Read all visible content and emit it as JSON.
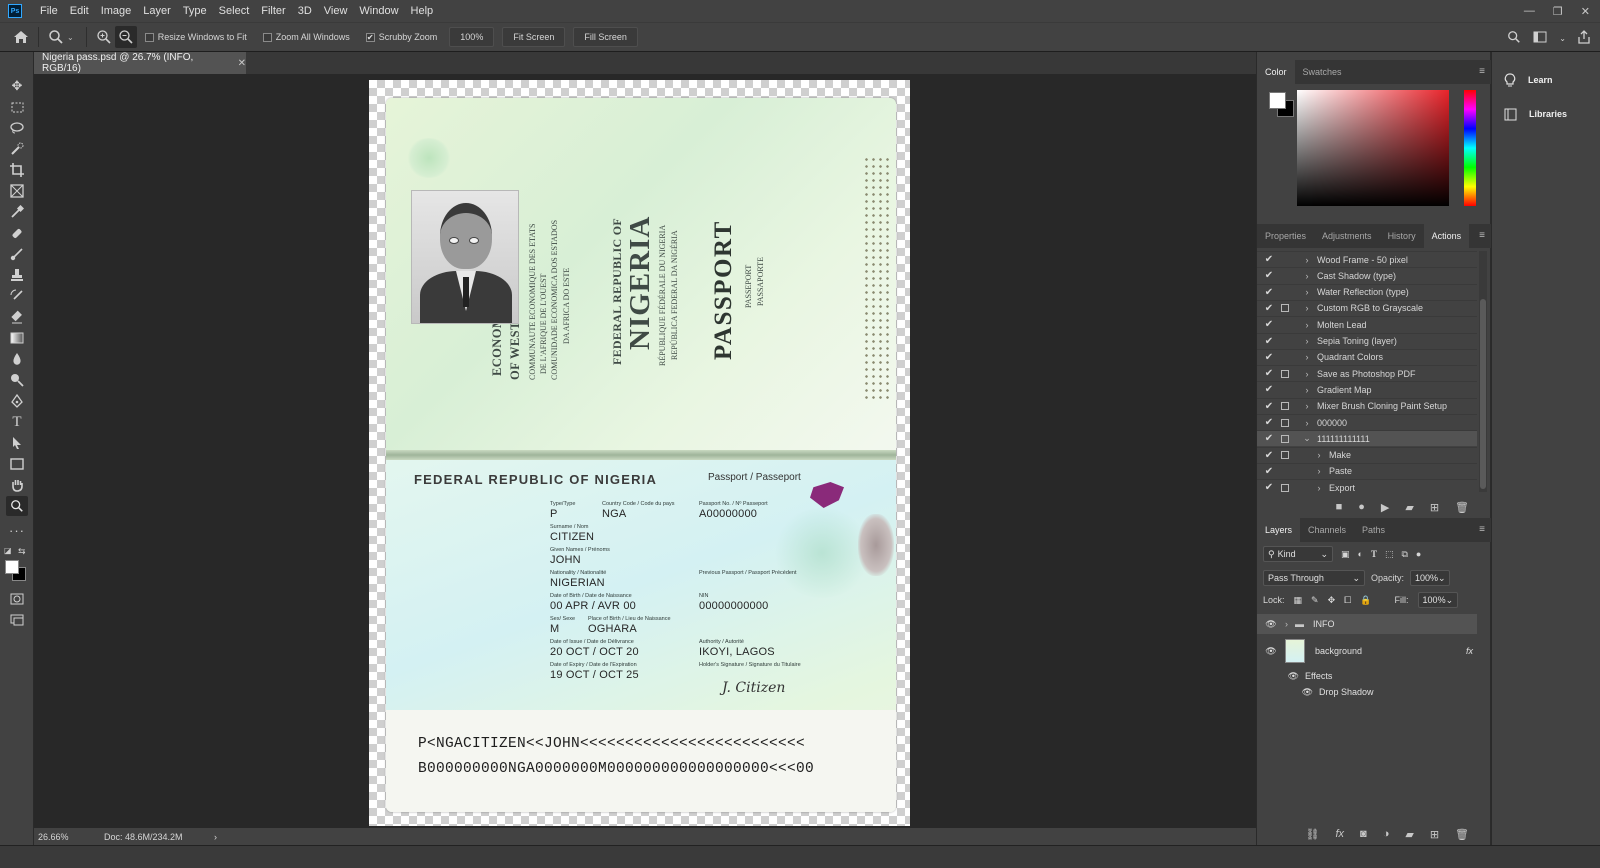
{
  "app": {
    "logo": "Ps"
  },
  "menu": [
    "File",
    "Edit",
    "Image",
    "Layer",
    "Type",
    "Select",
    "Filter",
    "3D",
    "View",
    "Window",
    "Help"
  ],
  "window_controls": {
    "minimize": "—",
    "restore": "❐",
    "close": "✕"
  },
  "options": {
    "resize_windows_label": "Resize Windows to Fit",
    "zoom_all_label": "Zoom All Windows",
    "scrubby_zoom_label": "Scrubby Zoom",
    "scrubby_checked": "✔",
    "zoom_value": "100%",
    "fit_screen": "Fit Screen",
    "fill_screen": "Fill Screen"
  },
  "document": {
    "tab_title": "Nigeria pass.psd @ 26.7% (INFO, RGB/16)",
    "tab_close": "✕"
  },
  "passport": {
    "ecowas": [
      "ECONOMIC COMMUNITY",
      "OF WEST AFRICAN STATES"
    ],
    "ecowas_sub": [
      "COMMUNAUTE ECONOMIQUE DES ETATS",
      "DE L'AFRIQUE DE L'OUEST",
      "COMUNIDADE ECONOMICA DOS ESTADOS",
      "DA AFRICA DO ESTE"
    ],
    "frn_top": "FEDERAL REPUBLIC OF",
    "nigeria": "NIGERIA",
    "frn_sub": [
      "RÉPUBLIQUE FÉDÉRALE DU NIGERIA",
      "REPÚBLICA FEDERAL DA NIGÉRIA"
    ],
    "passport_word": "PASSPORT",
    "passport_sub": [
      "PASSEPORT",
      "PASSAPORTE"
    ],
    "header": "FEDERAL REPUBLIC OF NIGERIA",
    "doc_label": "Passport / Passeport",
    "type_label": "Type/Type",
    "type": "P",
    "country_label": "Country Code / Code du pays",
    "country": "NGA",
    "passno_label": "Passport No. / Nº Passeport",
    "passno": "A00000000",
    "surname_label": "Surname / Nom",
    "surname": "CITIZEN",
    "given_label": "Given Names / Prénoms",
    "given": "JOHN",
    "nationality_label": "Nationality / Nationalité",
    "nationality": "NIGERIAN",
    "prev_label": "Previous Passport / Passport Précédent",
    "dob_label": "Date of Birth / Date de Naissance",
    "dob": "00 APR / AVR 00",
    "nin_label": "NIN",
    "nin": "00000000000",
    "sex_label": "Sex/ Sexe",
    "sex": "M",
    "pob_label": "Place of Birth / Lieu de Naissance",
    "pob": "OGHARA",
    "issue_label": "Date of Issue / Date de Délivrance",
    "issue": "20 OCT / OCT 20",
    "authority_label": "Authority / Autorité",
    "authority": "IKOYI, LAGOS",
    "expiry_label": "Date of Expiry / Date de l'Expiration",
    "expiry": "19 OCT / OCT 25",
    "holder_sig_label": "Holder's Signature / Signature du Titulaire",
    "signature": "J. Citizen",
    "mrz1": "P<NGACITIZEN<<JOHN<<<<<<<<<<<<<<<<<<<<<<<<<",
    "mrz2": "B000000000NGA0000000M000000000000000000<<<00"
  },
  "status": {
    "zoom": "26.66%",
    "doc": "Doc: 48.6M/234.2M",
    "arrow": "›"
  },
  "color_panel": {
    "tabs": [
      "Color",
      "Swatches"
    ],
    "active": 0
  },
  "actions_panel": {
    "tabs": [
      "Properties",
      "Adjustments",
      "History",
      "Actions"
    ],
    "active": 3,
    "items": [
      {
        "label": "Wood Frame - 50 pixel",
        "dialog": false,
        "indent": 0,
        "arrow": "›"
      },
      {
        "label": "Cast Shadow (type)",
        "dialog": false,
        "indent": 0,
        "arrow": "›"
      },
      {
        "label": "Water Reflection (type)",
        "dialog": false,
        "indent": 0,
        "arrow": "›"
      },
      {
        "label": "Custom RGB to Grayscale",
        "dialog": true,
        "indent": 0,
        "arrow": "›"
      },
      {
        "label": "Molten Lead",
        "dialog": false,
        "indent": 0,
        "arrow": "›"
      },
      {
        "label": "Sepia Toning (layer)",
        "dialog": false,
        "indent": 0,
        "arrow": "›"
      },
      {
        "label": "Quadrant Colors",
        "dialog": false,
        "indent": 0,
        "arrow": "›"
      },
      {
        "label": "Save as Photoshop PDF",
        "dialog": true,
        "indent": 0,
        "arrow": "›"
      },
      {
        "label": "Gradient Map",
        "dialog": false,
        "indent": 0,
        "arrow": "›"
      },
      {
        "label": "Mixer Brush Cloning Paint Setup",
        "dialog": true,
        "indent": 0,
        "arrow": "›"
      },
      {
        "label": "000000",
        "dialog": true,
        "indent": 0,
        "arrow": "›"
      },
      {
        "label": "111111111111",
        "dialog": true,
        "indent": 0,
        "arrow": "⌄",
        "selected": true
      },
      {
        "label": "Make",
        "dialog": true,
        "indent": 1,
        "arrow": "›"
      },
      {
        "label": "Paste",
        "dialog": false,
        "indent": 1,
        "arrow": "›"
      },
      {
        "label": "Export",
        "dialog": true,
        "indent": 1,
        "arrow": "›"
      }
    ],
    "check": "✔"
  },
  "layers_panel": {
    "tabs": [
      "Layers",
      "Channels",
      "Paths"
    ],
    "active": 0,
    "kind": "Kind",
    "blend": "Pass Through",
    "opacity_label": "Opacity:",
    "opacity": "100%",
    "lock_label": "Lock:",
    "fill_label": "Fill:",
    "fill": "100%",
    "layers": [
      {
        "name": "INFO",
        "type": "group"
      },
      {
        "name": "background",
        "type": "layer",
        "fx": "fx"
      }
    ],
    "effects_label": "Effects",
    "drop_shadow": "Drop Shadow"
  },
  "side_panels": [
    {
      "label": "Learn",
      "icon": "lightbulb-icon"
    },
    {
      "label": "Libraries",
      "icon": "libraries-icon"
    }
  ]
}
